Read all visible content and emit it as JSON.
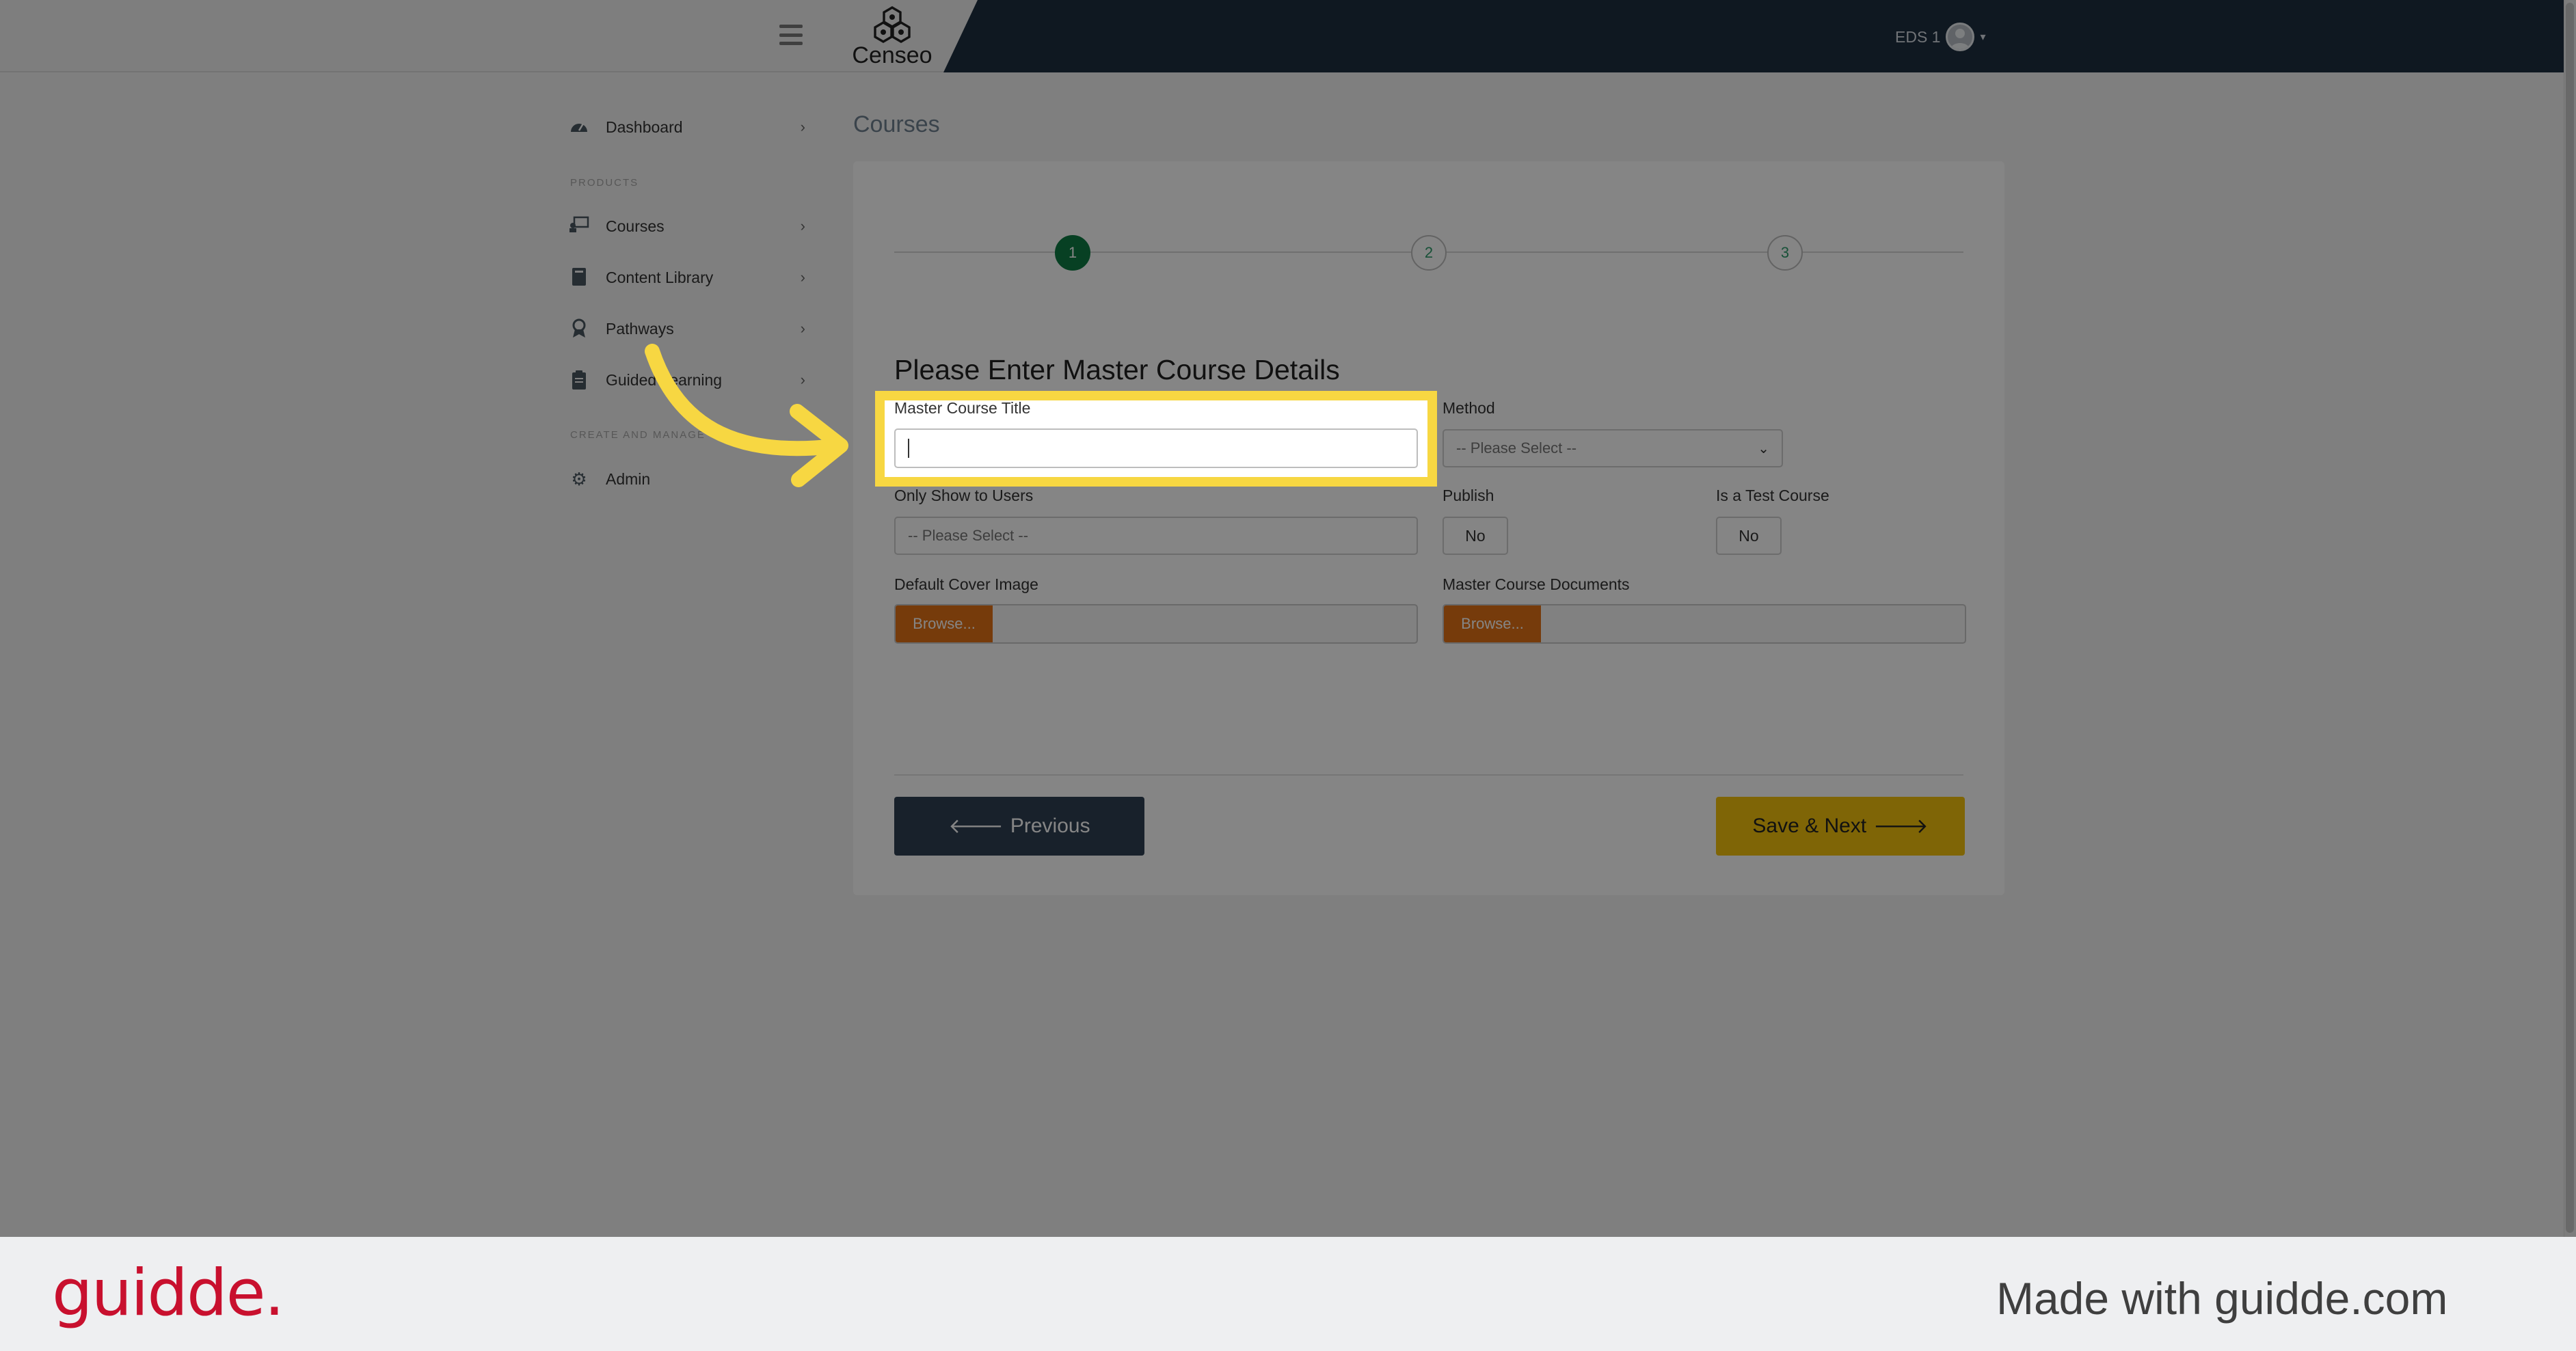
{
  "header": {
    "logo_text": "Censeo",
    "user_name": "EDS 1"
  },
  "sidebar": {
    "items": [
      {
        "label": "Dashboard"
      },
      {
        "label": "Courses"
      },
      {
        "label": "Content Library"
      },
      {
        "label": "Pathways"
      },
      {
        "label": "Guided Learning"
      },
      {
        "label": "Admin"
      }
    ],
    "sections": [
      "PRODUCTS",
      "CREATE AND MANAGE"
    ]
  },
  "page": {
    "title": "Courses"
  },
  "stepper": {
    "steps": [
      "1",
      "2",
      "3"
    ],
    "active_step": 1
  },
  "form": {
    "heading": "Please Enter Master Course Details",
    "master_course_title_label": "Master Course Title",
    "master_course_title_value": "",
    "method_label": "Method",
    "method_value": "-- Please Select --",
    "only_show_label": "Only Show to Users",
    "only_show_value": "-- Please Select --",
    "publish_label": "Publish",
    "publish_value": "No",
    "test_course_label": "Is a Test Course",
    "test_course_value": "No",
    "cover_image_label": "Default Cover Image",
    "documents_label": "Master Course Documents",
    "browse_label": "Browse..."
  },
  "actions": {
    "previous_label": "Previous",
    "save_next_label": "Save & Next"
  },
  "footer": {
    "brand": "guidde.",
    "made_with": "Made with guidde.com"
  },
  "colors": {
    "header_dark": "#1e2e40",
    "accent_green": "#0f7b43",
    "browse_orange": "#e37216",
    "save_yellow": "#f4c20d",
    "highlight_yellow": "#f7d742",
    "brand_red": "#c8102e"
  }
}
